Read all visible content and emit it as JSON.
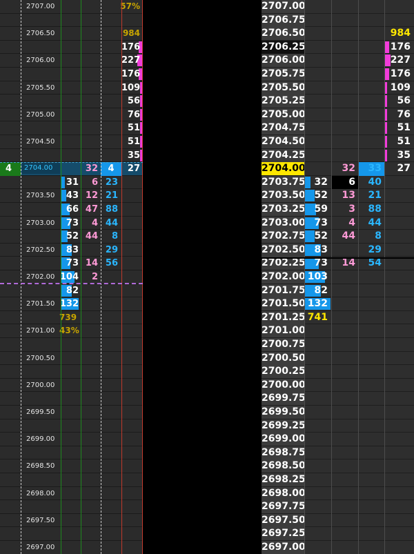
{
  "left_ladder": {
    "rows": [
      {
        "price": "2707.00",
        "bid": "",
        "ask": "",
        "bid2": "",
        "ask2": "",
        "extra": "57%",
        "extra_color": "gold"
      },
      {
        "price": "",
        "bid": "",
        "ask": "",
        "bid2": "",
        "ask2": "",
        "extra": "",
        "extra_color": ""
      },
      {
        "price": "2706.50",
        "bid": "",
        "ask": "",
        "bid2": "",
        "ask2": "",
        "extra": "984",
        "extra_color": "gold"
      },
      {
        "price": "",
        "bid": "",
        "ask": "",
        "bid2": "",
        "ask2": "176",
        "extra": "",
        "extra_color": ""
      },
      {
        "price": "2706.00",
        "bid": "",
        "ask": "",
        "bid2": "",
        "ask2": "227",
        "extra": "",
        "extra_color": ""
      },
      {
        "price": "",
        "bid": "",
        "ask": "",
        "bid2": "",
        "ask2": "176",
        "extra": "",
        "extra_color": ""
      },
      {
        "price": "2705.50",
        "bid": "",
        "ask": "",
        "bid2": "",
        "ask2": "109",
        "extra": "",
        "extra_color": ""
      },
      {
        "price": "",
        "bid": "",
        "ask": "",
        "bid2": "",
        "ask2": "56",
        "extra": "",
        "extra_color": ""
      },
      {
        "price": "2705.00",
        "bid": "",
        "ask": "",
        "bid2": "",
        "ask2": "76",
        "extra": "",
        "extra_color": ""
      },
      {
        "price": "",
        "bid": "",
        "ask": "",
        "bid2": "",
        "ask2": "51",
        "extra": "",
        "extra_color": ""
      },
      {
        "price": "2704.50",
        "bid": "",
        "ask": "",
        "bid2": "",
        "ask2": "51",
        "extra": "",
        "extra_color": ""
      },
      {
        "price": "",
        "bid": "",
        "ask": "",
        "bid2": "",
        "ask2": "35",
        "extra": "",
        "extra_color": ""
      },
      {
        "price": "2704.00",
        "bid": "",
        "ask": "",
        "bid2": "32",
        "ask2": "27",
        "extra": "",
        "extra_color": "",
        "mark": "4",
        "blue": "4"
      },
      {
        "price": "",
        "bid": "31",
        "ask": "6",
        "bid2": "23",
        "ask2": "",
        "extra": "",
        "extra_color": ""
      },
      {
        "price": "2703.50",
        "bid": "43",
        "ask": "12",
        "bid2": "21",
        "ask2": "",
        "extra": "",
        "extra_color": ""
      },
      {
        "price": "",
        "bid": "66",
        "ask": "47",
        "bid2": "88",
        "ask2": "",
        "extra": "",
        "extra_color": ""
      },
      {
        "price": "2703.00",
        "bid": "73",
        "ask": "4",
        "bid2": "44",
        "ask2": "",
        "extra": "",
        "extra_color": ""
      },
      {
        "price": "",
        "bid": "52",
        "ask": "44",
        "bid2": "8",
        "ask2": "",
        "extra": "",
        "extra_color": ""
      },
      {
        "price": "2702.50",
        "bid": "83",
        "ask": "",
        "bid2": "29",
        "ask2": "",
        "extra": "",
        "extra_color": ""
      },
      {
        "price": "",
        "bid": "73",
        "ask": "14",
        "bid2": "56",
        "ask2": "",
        "extra": "",
        "extra_color": ""
      },
      {
        "price": "2702.00",
        "bid": "104",
        "ask": "2",
        "bid2": "",
        "ask2": "",
        "extra": "",
        "extra_color": ""
      },
      {
        "price": "",
        "bid": "82",
        "ask": "",
        "bid2": "",
        "ask2": "",
        "extra": "",
        "extra_color": ""
      },
      {
        "price": "2701.50",
        "bid": "132",
        "ask": "",
        "bid2": "",
        "ask2": "",
        "extra": "",
        "extra_color": ""
      },
      {
        "price": "",
        "bid": "739",
        "ask": "",
        "bid2": "",
        "ask2": "",
        "extra": "",
        "extra_color": "",
        "bidgold": true
      },
      {
        "price": "2701.00",
        "bid": "43%",
        "ask": "",
        "bid2": "",
        "ask2": "",
        "extra": "",
        "extra_color": "",
        "bidgold": true
      },
      {
        "price": ""
      },
      {
        "price": "2700.50"
      },
      {
        "price": ""
      },
      {
        "price": "2700.00"
      },
      {
        "price": ""
      },
      {
        "price": "2699.50"
      },
      {
        "price": ""
      },
      {
        "price": "2699.00"
      },
      {
        "price": ""
      },
      {
        "price": "2698.50"
      },
      {
        "price": ""
      },
      {
        "price": "2698.00"
      },
      {
        "price": ""
      },
      {
        "price": "2697.50"
      },
      {
        "price": ""
      },
      {
        "price": "2697.00"
      }
    ]
  },
  "right_ladder": {
    "rows": [
      {
        "price": "2707.00",
        "c1": "",
        "c2": "",
        "c3": "",
        "c4": ""
      },
      {
        "price": "2706.75",
        "c1": "",
        "c2": "",
        "c3": "",
        "c4": ""
      },
      {
        "price": "2706.50",
        "c1": "",
        "c2": "",
        "c3": "",
        "c4": "984",
        "c4color": "yellow"
      },
      {
        "price": "2706.25",
        "c1": "",
        "c2": "",
        "c3": "",
        "c4": "176",
        "dark": true
      },
      {
        "price": "2706.00",
        "c1": "",
        "c2": "",
        "c3": "",
        "c4": "227"
      },
      {
        "price": "2705.75",
        "c1": "",
        "c2": "",
        "c3": "",
        "c4": "176"
      },
      {
        "price": "2705.50",
        "c1": "",
        "c2": "",
        "c3": "",
        "c4": "109"
      },
      {
        "price": "2705.25",
        "c1": "",
        "c2": "",
        "c3": "",
        "c4": "56"
      },
      {
        "price": "2705.00",
        "c1": "",
        "c2": "",
        "c3": "",
        "c4": "76"
      },
      {
        "price": "2704.75",
        "c1": "",
        "c2": "",
        "c3": "",
        "c4": "51"
      },
      {
        "price": "2704.50",
        "c1": "",
        "c2": "",
        "c3": "",
        "c4": "51"
      },
      {
        "price": "2704.25",
        "c1": "",
        "c2": "",
        "c3": "",
        "c4": "35"
      },
      {
        "price": "2704.00",
        "c1": "",
        "c2": "32",
        "c3": "33",
        "c4": "27",
        "current": true
      },
      {
        "price": "2703.75",
        "c1": "32",
        "c2": "6",
        "c3": "40",
        "c4": ""
      },
      {
        "price": "2703.50",
        "c1": "52",
        "c2": "13",
        "c3": "21",
        "c4": ""
      },
      {
        "price": "2703.25",
        "c1": "59",
        "c2": "3",
        "c3": "88",
        "c4": ""
      },
      {
        "price": "2703.00",
        "c1": "73",
        "c2": "4",
        "c3": "44",
        "c4": ""
      },
      {
        "price": "2702.75",
        "c1": "52",
        "c2": "44",
        "c3": "8",
        "c4": ""
      },
      {
        "price": "2702.50",
        "c1": "83",
        "c2": "",
        "c3": "29",
        "c4": ""
      },
      {
        "price": "2702.25",
        "c1": "73",
        "c2": "14",
        "c3": "54",
        "c4": ""
      },
      {
        "price": "2702.00",
        "c1": "103",
        "c2": "",
        "c3": "",
        "c4": ""
      },
      {
        "price": "2701.75",
        "c1": "82",
        "c2": "",
        "c3": "",
        "c4": ""
      },
      {
        "price": "2701.50",
        "c1": "132",
        "c2": "",
        "c3": "",
        "c4": ""
      },
      {
        "price": "2701.25",
        "c1": "741",
        "c2": "",
        "c3": "",
        "c4": "",
        "c1color": "yellow"
      },
      {
        "price": "2701.00"
      },
      {
        "price": "2700.75"
      },
      {
        "price": "2700.50"
      },
      {
        "price": "2700.25"
      },
      {
        "price": "2700.00"
      },
      {
        "price": "2699.75"
      },
      {
        "price": "2699.50"
      },
      {
        "price": "2699.25"
      },
      {
        "price": "2699.00"
      },
      {
        "price": "2698.75"
      },
      {
        "price": "2698.50"
      },
      {
        "price": "2698.25"
      },
      {
        "price": "2698.00"
      },
      {
        "price": "2697.75"
      },
      {
        "price": "2697.50"
      },
      {
        "price": "2697.25"
      },
      {
        "price": "2697.00"
      }
    ]
  },
  "colors": {
    "blue": "#1597ea",
    "pink": "#f13cd9",
    "gold": "#c7a400",
    "yellow": "#ffe800",
    "cyan": "#2ab6ff",
    "lightpink": "#ff9ad6"
  }
}
